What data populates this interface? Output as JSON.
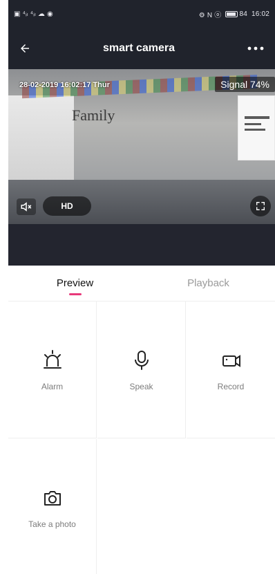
{
  "status_bar": {
    "left": "▣ ⁴ᵢₗ ⁴ᵢₗ ☁ ◉",
    "right_icons": "⚙ N ⓞ",
    "battery": "84",
    "time": "16:02"
  },
  "header": {
    "title": "smart camera"
  },
  "video": {
    "timestamp": "28-02-2019 16:02:17 Thur",
    "signal": "Signal 74%",
    "hd_label": "HD",
    "scene_text": "Family"
  },
  "tabs": [
    {
      "label": "Preview",
      "active": true
    },
    {
      "label": "Playback",
      "active": false
    }
  ],
  "actions": [
    {
      "label": "Alarm",
      "icon": "alarm-icon"
    },
    {
      "label": "Speak",
      "icon": "microphone-icon"
    },
    {
      "label": "Record",
      "icon": "video-record-icon"
    },
    {
      "label": "Take a photo",
      "icon": "camera-icon"
    }
  ],
  "colors": {
    "header_bg": "#20232c",
    "accent": "#e8397a",
    "divider": "#eeeeee"
  }
}
